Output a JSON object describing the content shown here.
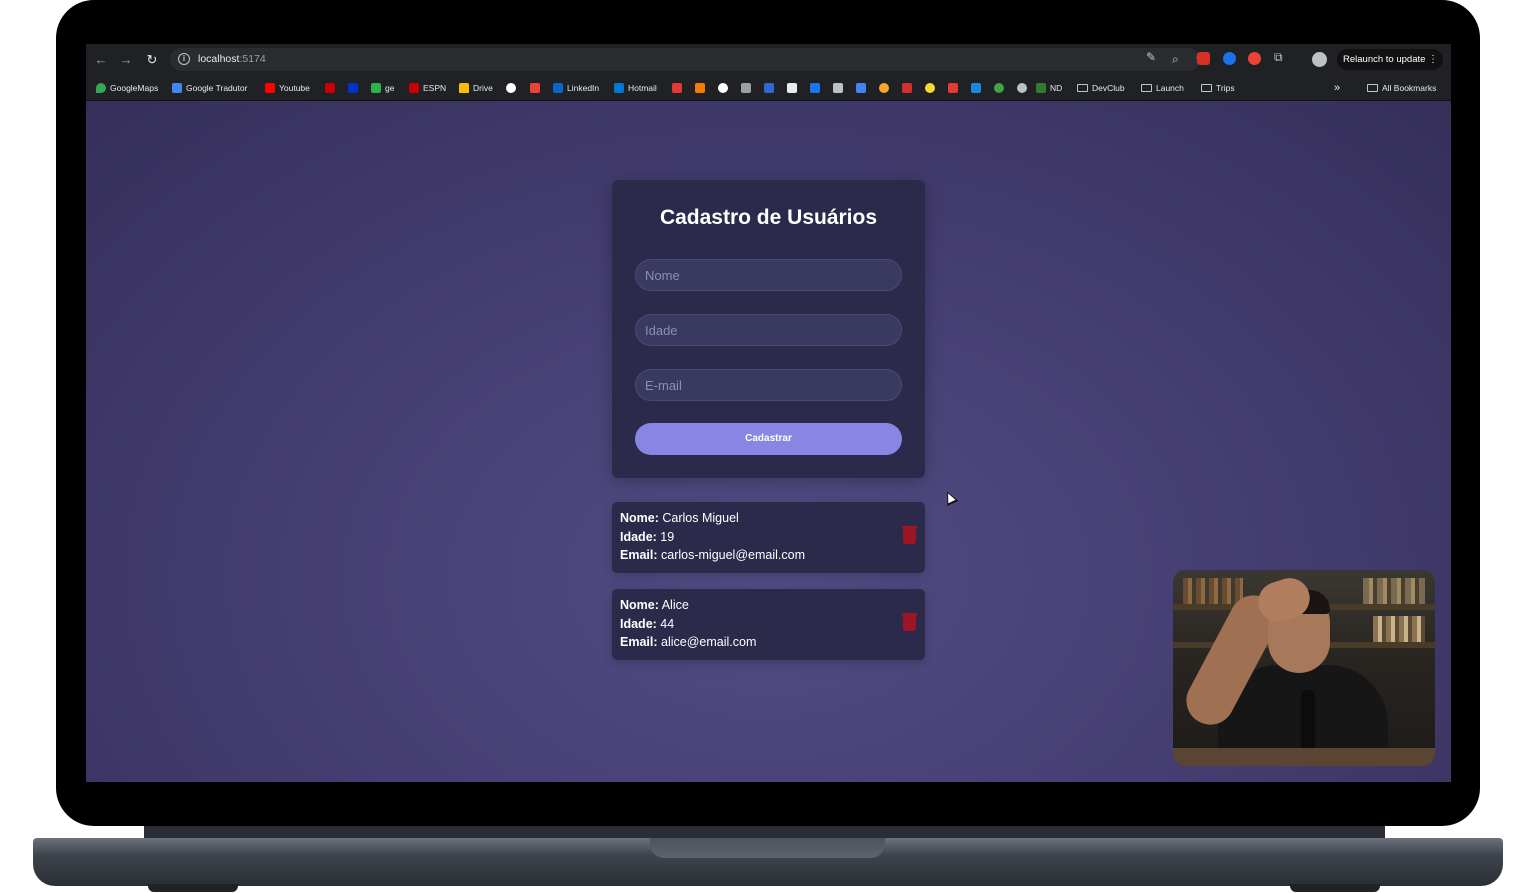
{
  "browser": {
    "url_host": "localhost",
    "url_port": ":5174",
    "relaunch_label": "Relaunch to update"
  },
  "bookmarks": {
    "items": [
      "GoogleMaps",
      "Google Tradutor",
      "Youtube",
      "ge",
      "ESPN",
      "Drive",
      "LinkedIn",
      "Hotmail",
      "ND"
    ],
    "folders": [
      "DevClub",
      "Launch",
      "Trips"
    ],
    "all_bookmarks": "All Bookmarks"
  },
  "form": {
    "title": "Cadastro de Usuários",
    "name_placeholder": "Nome",
    "age_placeholder": "Idade",
    "email_placeholder": "E-mail",
    "submit_label": "Cadastrar"
  },
  "labels": {
    "name": "Nome:",
    "age": "Idade:",
    "email": "Email:"
  },
  "users": [
    {
      "name": "Carlos Miguel",
      "age": "19",
      "email": "carlos-miguel@email.com"
    },
    {
      "name": "Alice",
      "age": "44",
      "email": "alice@email.com"
    }
  ],
  "colors": {
    "page_bg": "#463f74",
    "card_bg": "#2b2a4b",
    "accent": "#8885e3",
    "delete": "#9e1626"
  }
}
